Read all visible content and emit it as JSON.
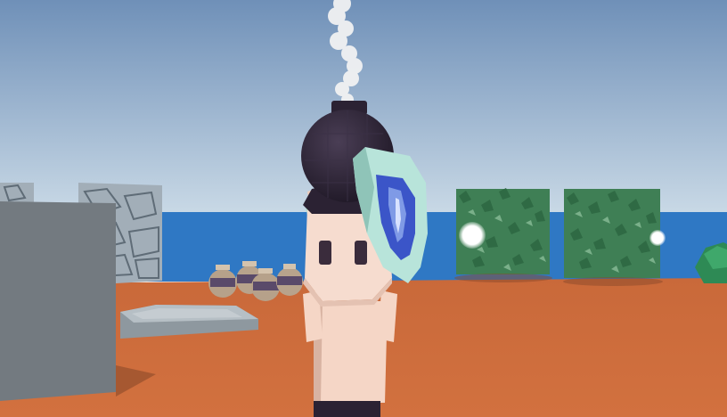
{
  "scene": {
    "type": "third-person-3d-game-view",
    "hud_text": [],
    "colors": {
      "sky_top": "#6f90b8",
      "sky_horizon": "#c9d9e6",
      "sea": "#2f78c4",
      "ground": "#cc6a3a",
      "stone": "#9aa6b0",
      "stone_dark": "#6b7a86",
      "character_skin": "#f3d2c2",
      "hair": "#2b2233",
      "bomb": "#2b2233",
      "shield_rim": "#b8e4da",
      "shield_face": "#3b55c8",
      "hedge": "#3b7a52",
      "bush": "#2e8a55",
      "smoke": "#f4f4f4",
      "glow": "#ffffff"
    },
    "objects": [
      "player-character",
      "bomb-on-head",
      "smoke-trail",
      "shield",
      "stone-wall",
      "stone-slab",
      "pottery-jars",
      "hedge-left",
      "hedge-right",
      "bush",
      "glowing-orb"
    ]
  }
}
